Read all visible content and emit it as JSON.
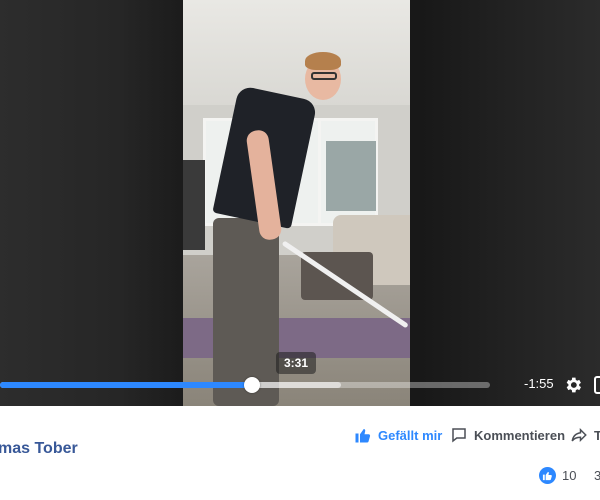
{
  "player": {
    "hover_time": "3:31",
    "remaining_time": "-1:55",
    "progress_fraction": 0.515,
    "buffered_fraction": 0.695,
    "accent_color": "#2d88ff"
  },
  "post": {
    "author": "mas Tober"
  },
  "actions": {
    "like_label": "Gefällt mir",
    "comment_label": "Kommentieren",
    "share_label": "T",
    "like_icon": "thumbs-up-icon",
    "comment_icon": "speech-bubble-icon",
    "share_icon": "share-arrow-icon"
  },
  "reactions": {
    "count": "10",
    "comments_count": "3"
  }
}
